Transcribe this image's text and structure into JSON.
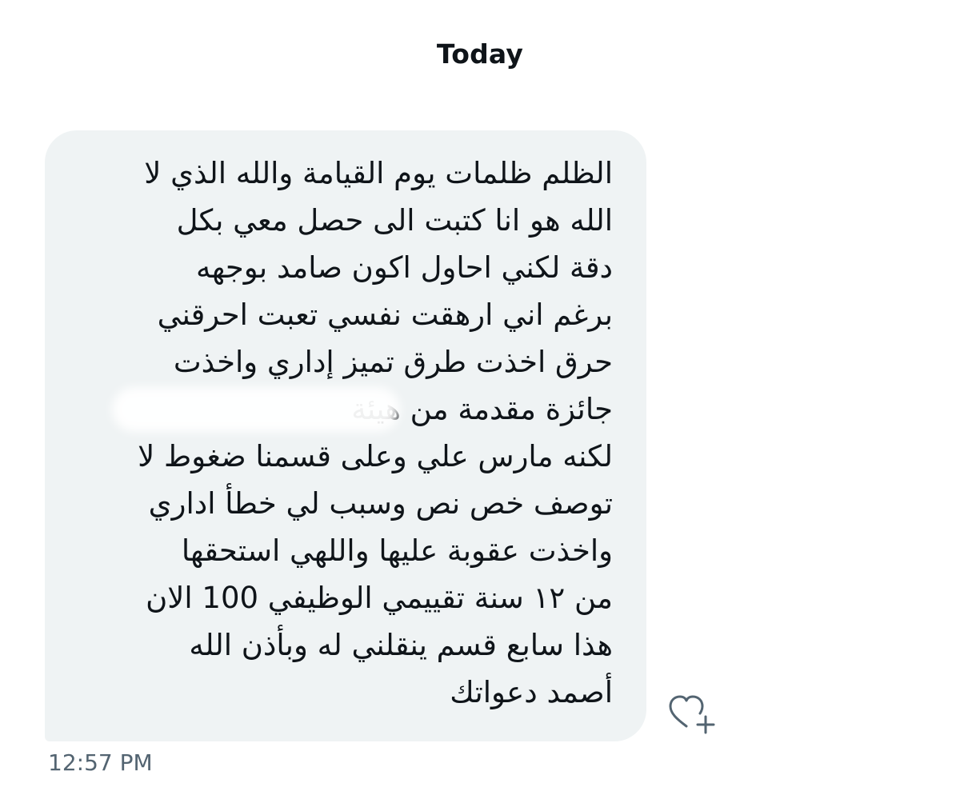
{
  "conversation": {
    "date_label": "Today"
  },
  "message": {
    "lines": [
      "الظلم ظلمات يوم القيامة والله الذي لا",
      "الله هو انا كتبت الى حصل معي بكل",
      "دقة لكني احاول اكون صامد بوجهه",
      "برغم اني ارهقت نفسي تعبت احرقني",
      "حرق اخذت طرق تميز إداري واخذت",
      "جائزة مقدمة من هيئة",
      "لكنه مارس علي وعلى قسمنا ضغوط لا",
      "توصف خص نص وسبب لي خطأ اداري",
      "واخذت عقوبة عليها واللهي استحقها",
      "من ١٢ سنة تقييمي الوظيفي 100 الان",
      "هذا سابع قسم ينقلني له وبأذن الله",
      "أصمد دعواتك"
    ],
    "timestamp": "12:57 PM"
  },
  "react_button": {
    "icon": "heart-plus-icon"
  },
  "colors": {
    "bubble_background": "#eff3f4",
    "text": "#0f1419",
    "muted_text": "#536471",
    "icon": "#536471"
  }
}
